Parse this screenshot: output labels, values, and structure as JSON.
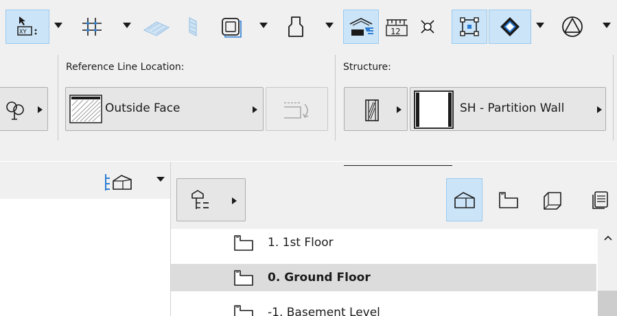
{
  "toolbar": {
    "buttons": [
      {
        "name": "coordinate-input-icon",
        "active": true
      },
      {
        "name": "grid-snap-icon",
        "active": false
      },
      {
        "name": "slab-tool-icon",
        "active": false
      },
      {
        "name": "wall-face-icon",
        "active": false
      },
      {
        "name": "frame-icon",
        "active": false
      },
      {
        "name": "profile-shape-icon",
        "active": false
      },
      {
        "name": "structure-display-icon",
        "active": true
      },
      {
        "name": "dimension-12-icon",
        "active": false
      },
      {
        "name": "intersection-icon",
        "active": false
      },
      {
        "name": "bounding-box-icon",
        "active": true
      },
      {
        "name": "surface-3d-icon",
        "active": true
      },
      {
        "name": "geometry-method-icon",
        "active": false
      }
    ]
  },
  "info_box": {
    "reference_line": {
      "caption": "Reference Line Location:",
      "value": "Outside Face"
    },
    "structure": {
      "caption": "Structure:",
      "value": "SH - Partition Wall"
    }
  },
  "navigator": {
    "stories": [
      {
        "label": "1. 1st Floor",
        "selected": false
      },
      {
        "label": "0. Ground Floor",
        "selected": true
      },
      {
        "label": "-1. Basement Level",
        "selected": false
      }
    ]
  },
  "colors": {
    "active_bg": "#cce4f7",
    "active_border": "#99c9ef",
    "panel_bg": "#f0f0f0",
    "selected_row": "#dcdcdc"
  }
}
